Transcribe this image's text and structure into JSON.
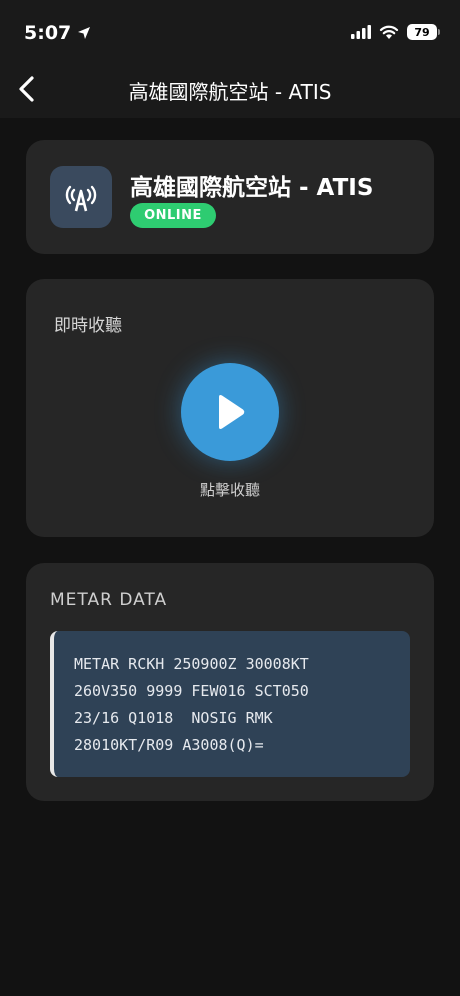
{
  "status_bar": {
    "time": "5:07",
    "battery": "79"
  },
  "nav": {
    "title": "高雄國際航空站 - ATIS"
  },
  "station": {
    "name": "高雄國際航空站 - ATIS",
    "status": "ONLINE",
    "status_color": "#2ecc71",
    "icon": "antenna-icon"
  },
  "live": {
    "label": "即時收聽",
    "play_caption": "點擊收聽",
    "accent": "#3a9ad9"
  },
  "metar": {
    "heading": "METAR DATA",
    "lines": [
      "METAR RCKH 250900Z 30008KT",
      "260V350 9999 FEW016 SCT050",
      "23/16 Q1018  NOSIG RMK",
      "28010KT/R09 A3008(Q)="
    ]
  }
}
